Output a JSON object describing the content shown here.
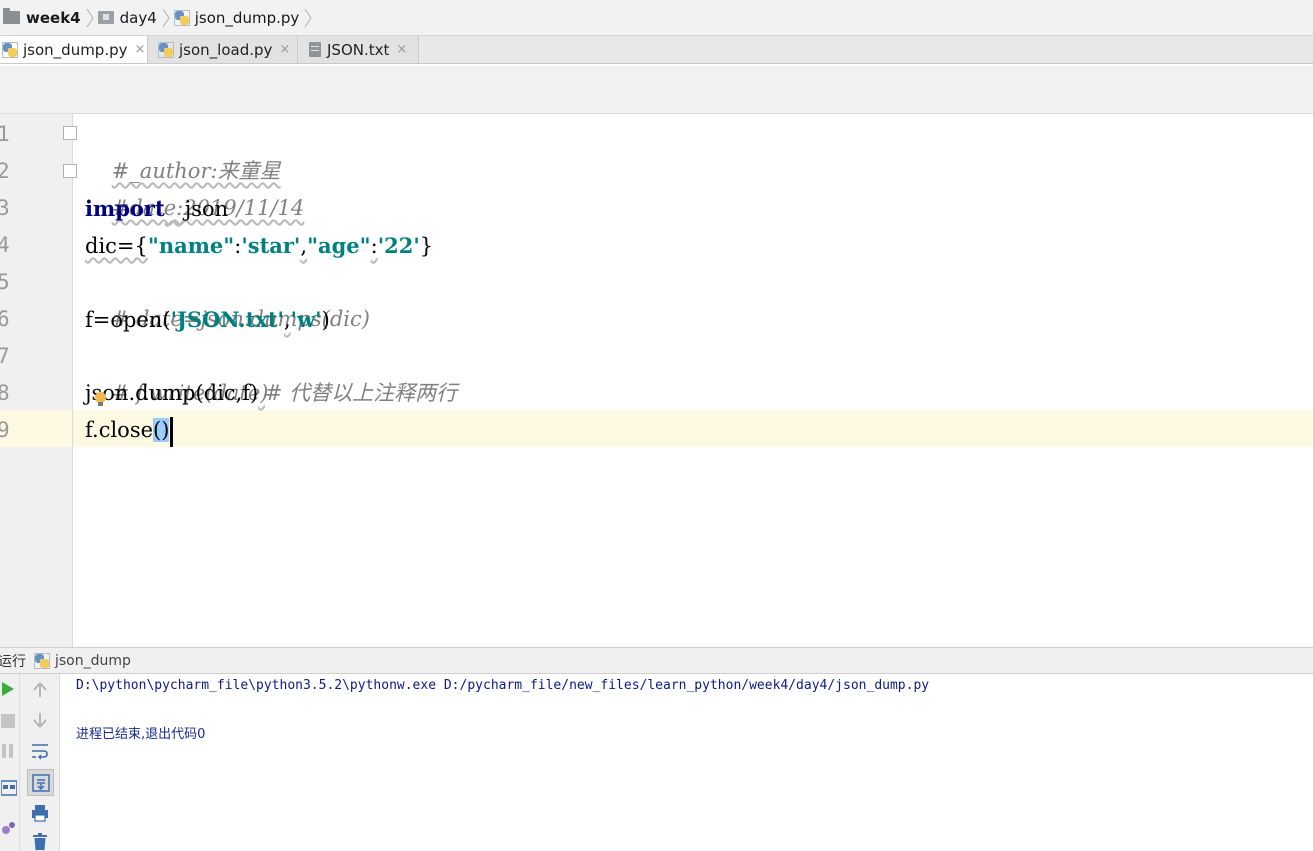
{
  "breadcrumb": {
    "items": [
      {
        "label": "week4",
        "icon": "folder-icon"
      },
      {
        "label": "day4",
        "icon": "package-icon"
      },
      {
        "label": "json_dump.py",
        "icon": "python-file-icon"
      }
    ]
  },
  "tabs": [
    {
      "label": "json_dump.py",
      "close": "×",
      "active": true,
      "icon": "python-file-icon"
    },
    {
      "label": "json_load.py",
      "close": "×",
      "active": false,
      "icon": "python-file-icon"
    },
    {
      "label": "JSON.txt",
      "close": "×",
      "active": false,
      "icon": "text-file-icon"
    }
  ],
  "editor": {
    "line_numbers": [
      "1",
      "2",
      "3",
      "4",
      "5",
      "6",
      "7",
      "8",
      "9"
    ],
    "current_line": 9,
    "lines": {
      "l1": "#_author:来童星",
      "l2": "#date:2019/11/14",
      "l3_kw": "import",
      "l3_rest": "json",
      "l4_a": "dic={",
      "l4_s1": "\"name\"",
      "l4_c1": ":",
      "l4_s2": "'star'",
      "l4_c2": ",",
      "l4_s3": "\"age\"",
      "l4_c3": ":",
      "l4_s4": "'22'",
      "l4_b": "}",
      "l5": "# date=json.dumps(dic)",
      "l6_a": "f=open(",
      "l6_s1": "'JSON.txt'",
      "l6_c": ",",
      "l6_s2": "'w'",
      "l6_b": ")",
      "l7": "# f.write(date)",
      "l8_a": "json.dump(dic,f)",
      "l8_cm": "# 代替以上注释两行",
      "l9_a": "f.close",
      "l9_b": "()"
    }
  },
  "run_panel": {
    "label": "运行",
    "config_name": "json_dump",
    "output": [
      "D:\\python\\pycharm_file\\python3.5.2\\pythonw.exe D:/pycharm_file/new_files/learn_python/week4/day4/json_dump.py",
      "",
      "进程已结束,退出代码0"
    ]
  },
  "colors": {
    "keyword": "#000080",
    "string": "#008080",
    "comment": "#808080",
    "caret_line": "#fdf9e3",
    "brace_highlight": "#99ccff",
    "console_text": "#0b1a8a",
    "run_green": "#3dab3d"
  }
}
